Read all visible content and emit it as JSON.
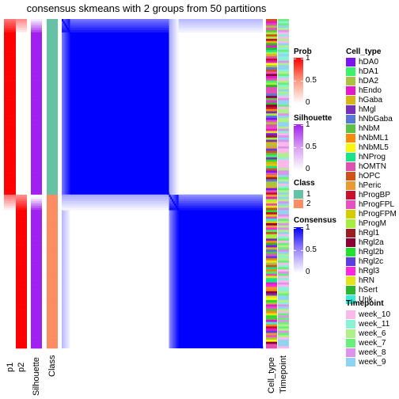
{
  "chart_data": {
    "type": "heatmap",
    "title": "consensus skmeans with 2 groups from 50 partitions",
    "n_samples": 150,
    "groups": [
      {
        "class": 1,
        "fraction": 0.53
      },
      {
        "class": 2,
        "fraction": 0.47
      }
    ],
    "annotation_columns_left": [
      "p1",
      "p2",
      "Silhouette",
      "Class"
    ],
    "annotation_columns_right": [
      "Cell_type",
      "Timepoint"
    ],
    "consensus_within_class": 1.0,
    "consensus_between_class": 0.0,
    "legends": {
      "prob": {
        "title": "Prob",
        "ticks": [
          "1",
          "0.5",
          "0"
        ],
        "range": [
          0,
          1
        ],
        "colors": [
          "#FFFFFF",
          "#FF0000"
        ]
      },
      "silhouette": {
        "title": "Silhouette",
        "ticks": [
          "1",
          "0.5",
          "0"
        ],
        "range": [
          0,
          1
        ],
        "colors": [
          "#FFFFFF",
          "#A020F0"
        ]
      },
      "class": {
        "title": "Class",
        "items": [
          {
            "label": "1",
            "color": "#66C2A5"
          },
          {
            "label": "2",
            "color": "#FC8D62"
          }
        ]
      },
      "consensus": {
        "title": "Consensus",
        "ticks": [
          "1",
          "0.5",
          "0"
        ],
        "range": [
          0,
          1
        ],
        "colors": [
          "#FFFFFF",
          "#0000FF"
        ]
      },
      "cell_type": {
        "title": "Cell_type",
        "items": [
          {
            "label": "hDA0",
            "color": "#7B16F0"
          },
          {
            "label": "hDA1",
            "color": "#3CF26A"
          },
          {
            "label": "hDA2",
            "color": "#A9C240"
          },
          {
            "label": "hEndo",
            "color": "#E519C9"
          },
          {
            "label": "hGaba",
            "color": "#D9B415"
          },
          {
            "label": "hMgl",
            "color": "#7A2FB8"
          },
          {
            "label": "hNbGaba",
            "color": "#5A77D8"
          },
          {
            "label": "hNbM",
            "color": "#5BC246"
          },
          {
            "label": "hNbML1",
            "color": "#F58A0E"
          },
          {
            "label": "hNbML5",
            "color": "#F7F712"
          },
          {
            "label": "hNProg",
            "color": "#1BE38A"
          },
          {
            "label": "hOMTN",
            "color": "#E050B0"
          },
          {
            "label": "hOPC",
            "color": "#D1501A"
          },
          {
            "label": "hPeric",
            "color": "#E99A30"
          },
          {
            "label": "hProgBP",
            "color": "#C8102E"
          },
          {
            "label": "hProgFPL",
            "color": "#E650C0"
          },
          {
            "label": "hProgFPM",
            "color": "#D4CC00"
          },
          {
            "label": "hProgM",
            "color": "#A5EE40"
          },
          {
            "label": "hRgl1",
            "color": "#9A1E1E"
          },
          {
            "label": "hRgl2a",
            "color": "#8E0035"
          },
          {
            "label": "hRgl2b",
            "color": "#22E030"
          },
          {
            "label": "hRgl2c",
            "color": "#5A3EE0"
          },
          {
            "label": "hRgl3",
            "color": "#FF28E0"
          },
          {
            "label": "hRN",
            "color": "#E3E31C"
          },
          {
            "label": "hSert",
            "color": "#2DB52D"
          },
          {
            "label": "Unk",
            "color": "#33EEDD"
          }
        ]
      },
      "timepoint": {
        "title": "Timepoint",
        "items": [
          {
            "label": "week_10",
            "color": "#F9B9EC"
          },
          {
            "label": "week_11",
            "color": "#8AF0D8"
          },
          {
            "label": "week_6",
            "color": "#B0F08A"
          },
          {
            "label": "week_7",
            "color": "#6AEF7A"
          },
          {
            "label": "week_8",
            "color": "#DE92EC"
          },
          {
            "label": "week_9",
            "color": "#8FD4F2"
          }
        ]
      }
    }
  }
}
